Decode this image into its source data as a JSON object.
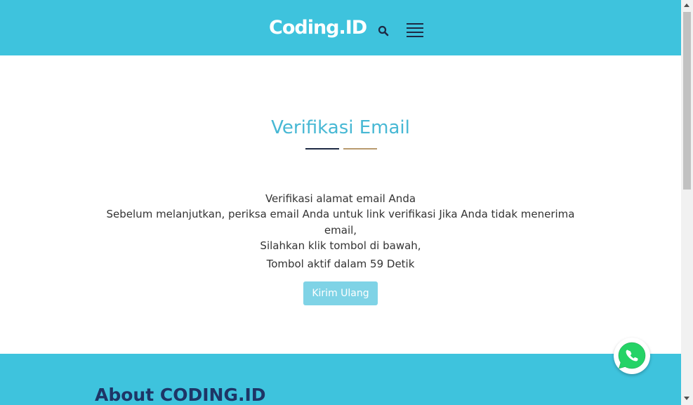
{
  "header": {
    "logo": "Coding.ID",
    "search_icon": "search-icon",
    "menu_icon": "hamburger-menu-icon"
  },
  "main": {
    "title": "Verifikasi Email",
    "line1": "Verifikasi alamat email Anda",
    "line2": "Sebelum melanjutkan, periksa email Anda untuk link verifikasi Jika Anda tidak menerima",
    "line3": "email,",
    "line4": "Silahkan klik tombol di bawah,",
    "line5": "Tombol aktif dalam 59 Detik",
    "resend_button": "Kirim Ulang"
  },
  "footer": {
    "about_title": "About CODING.ID"
  },
  "floating": {
    "whatsapp_icon": "whatsapp-icon"
  },
  "colors": {
    "brand": "#3ec3dd",
    "title": "#47b8d4",
    "button": "#7fd3e6",
    "dark_navy": "#1e2a44",
    "gold": "#b89a6e"
  }
}
